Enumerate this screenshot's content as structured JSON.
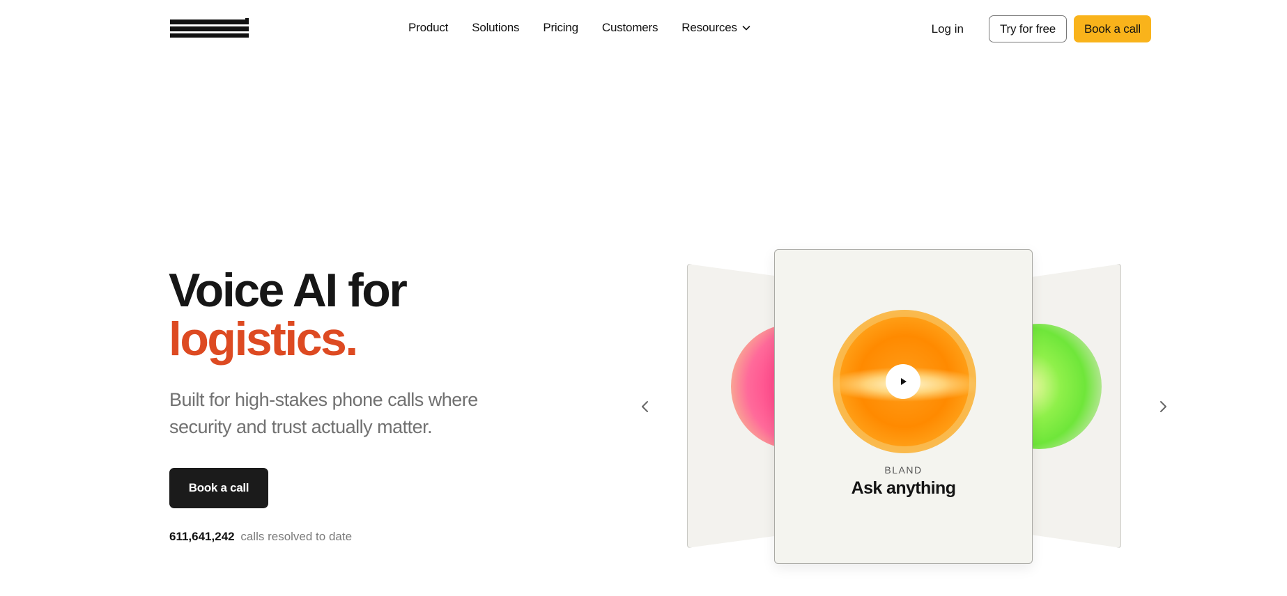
{
  "nav": {
    "logo_text": "bland",
    "links": [
      {
        "label": "Product"
      },
      {
        "label": "Solutions"
      },
      {
        "label": "Pricing"
      },
      {
        "label": "Customers"
      },
      {
        "label": "Resources"
      }
    ],
    "login_label": "Log in",
    "try_label": "Try for free",
    "book_label": "Book a call"
  },
  "hero": {
    "title_line1": "Voice AI for",
    "title_accent": "logistics.",
    "subtitle": "Built for high-stakes phone calls where security and trust actually matter.",
    "cta_label": "Book a call",
    "stat_number": "611,641,242",
    "stat_label": "calls resolved to date"
  },
  "carousel": {
    "active_card": {
      "brand": "BLAND",
      "title": "Ask anything"
    }
  },
  "colors": {
    "accent": "#dd4a22",
    "cta_yellow": "#f9b31b",
    "cta_dark": "#1b1b1b"
  },
  "icons": [
    "chevron-down-icon",
    "chevron-left-icon",
    "chevron-right-icon",
    "play-icon"
  ]
}
